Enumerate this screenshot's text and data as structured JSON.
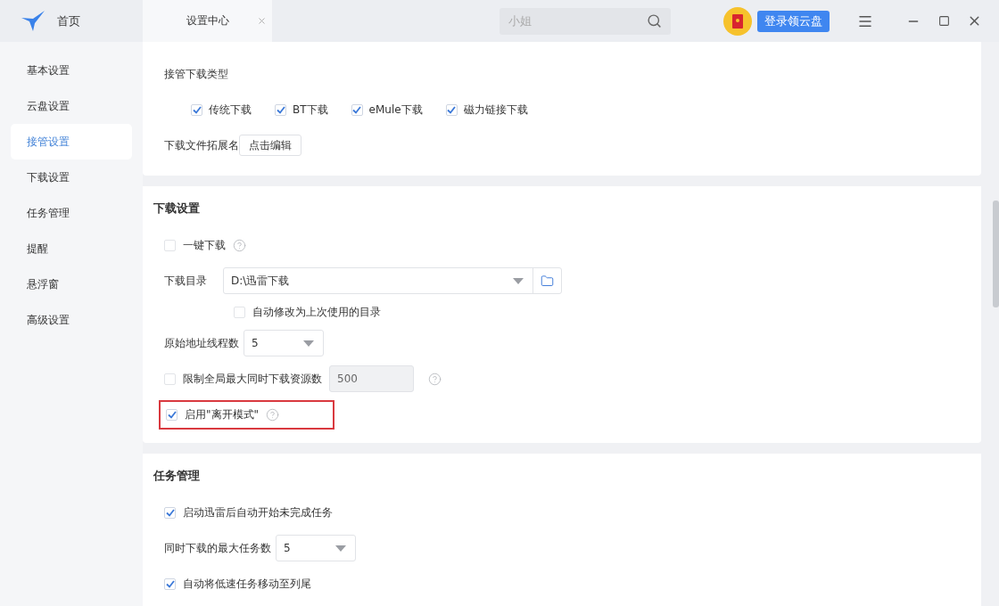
{
  "titlebar": {
    "home": "首页",
    "tab": {
      "label": "设置中心"
    },
    "search": {
      "placeholder": "小姐"
    },
    "login_button": "登录领云盘"
  },
  "sidebar": {
    "items": [
      {
        "label": "基本设置",
        "selected": false
      },
      {
        "label": "云盘设置",
        "selected": false
      },
      {
        "label": "接管设置",
        "selected": true
      },
      {
        "label": "下载设置",
        "selected": false
      },
      {
        "label": "任务管理",
        "selected": false
      },
      {
        "label": "提醒",
        "selected": false
      },
      {
        "label": "悬浮窗",
        "selected": false
      },
      {
        "label": "高级设置",
        "selected": false
      }
    ]
  },
  "sections": [
    {
      "rows": [
        {
          "kind": "label",
          "text": "接管下载类型"
        },
        {
          "kind": "checkgroup",
          "items": [
            {
              "label": "传统下载",
              "checked": true
            },
            {
              "label": "BT下载",
              "checked": true
            },
            {
              "label": "eMule下载",
              "checked": true
            },
            {
              "label": "磁力链接下载",
              "checked": true
            }
          ]
        },
        {
          "kind": "button",
          "label": "下载文件拓展名",
          "button": "点击编辑"
        }
      ]
    },
    {
      "title": "下载设置",
      "rows": [
        {
          "kind": "checkbox",
          "label": "一键下载",
          "checked": false,
          "help": true
        },
        {
          "kind": "path",
          "label": "下载目录",
          "value": "D:\\迅雷下载"
        },
        {
          "kind": "subcheckbox",
          "label": "自动修改为上次使用的目录",
          "checked": false
        },
        {
          "kind": "select",
          "label": "原始地址线程数",
          "value": "5"
        },
        {
          "kind": "limit",
          "label": "限制全局最大同时下载资源数",
          "checked": false,
          "value": "500",
          "disabled": true,
          "help": true
        },
        {
          "kind": "checkbox",
          "label": "启用\"离开模式\"",
          "checked": true,
          "help": true,
          "highlighted": true
        }
      ]
    },
    {
      "title": "任务管理",
      "rows": [
        {
          "kind": "checkbox",
          "label": "启动迅雷后自动开始未完成任务",
          "checked": true
        },
        {
          "kind": "select",
          "label": "同时下载的最大任务数",
          "value": "5"
        },
        {
          "kind": "checkbox",
          "label": "自动将低速任务移动至列尾",
          "checked": true
        }
      ]
    }
  ]
}
